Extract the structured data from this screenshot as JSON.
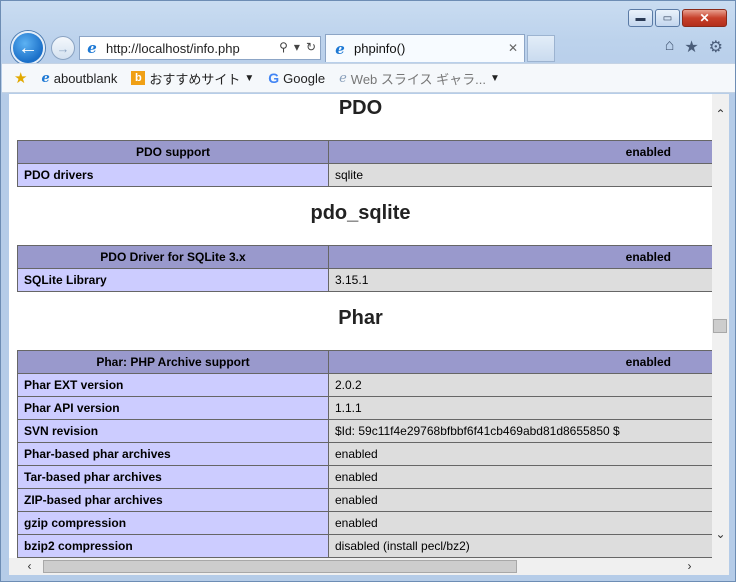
{
  "window": {
    "minimize_label": "▬",
    "maximize_label": "▭",
    "close_label": "✕"
  },
  "nav": {
    "back_label": "←",
    "forward_label": "→",
    "address": "http://localhost/info.php",
    "search_icon": "⚲",
    "dropdown_icon": "▾",
    "refresh_icon": "↻"
  },
  "tab": {
    "title": "phpinfo()",
    "close_label": "✕"
  },
  "toolbar_icons": {
    "home": "⌂",
    "favorites": "★",
    "settings": "⚙"
  },
  "favorites_bar": {
    "items": [
      {
        "label": "aboutblank"
      },
      {
        "label": "おすすめサイト"
      },
      {
        "label": "Google"
      },
      {
        "label": "Web スライス ギャラ..."
      }
    ]
  },
  "content": {
    "sections": [
      {
        "title": "PDO",
        "header": [
          "PDO support",
          "enabled"
        ],
        "rows": [
          [
            "PDO drivers",
            "sqlite"
          ]
        ]
      },
      {
        "title": "pdo_sqlite",
        "header": [
          "PDO Driver for SQLite 3.x",
          "enabled"
        ],
        "rows": [
          [
            "SQLite Library",
            "3.15.1"
          ]
        ]
      },
      {
        "title": "Phar",
        "header": [
          "Phar: PHP Archive support",
          "enabled"
        ],
        "rows": [
          [
            "Phar EXT version",
            "2.0.2"
          ],
          [
            "Phar API version",
            "1.1.1"
          ],
          [
            "SVN revision",
            "$Id: 59c11f4e29768bfbbf6f41cb469abd81d8655850 $"
          ],
          [
            "Phar-based phar archives",
            "enabled"
          ],
          [
            "Tar-based phar archives",
            "enabled"
          ],
          [
            "ZIP-based phar archives",
            "enabled"
          ],
          [
            "gzip compression",
            "enabled"
          ],
          [
            "bzip2 compression",
            "disabled (install pecl/bz2)"
          ]
        ]
      }
    ]
  },
  "scrollbars": {
    "up": "⌃",
    "down": "⌄",
    "left": "‹",
    "right": "›"
  }
}
